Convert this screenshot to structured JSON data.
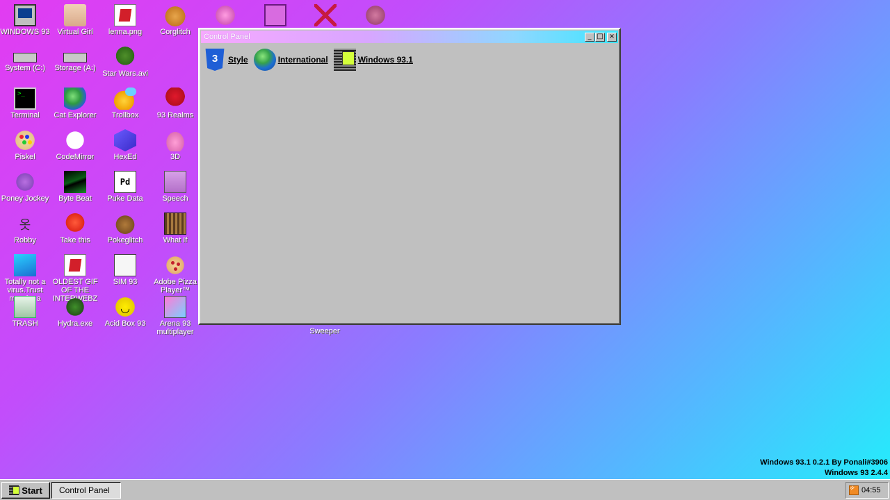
{
  "desktop": {
    "icons": [
      {
        "label": "WINDOWS 93",
        "icon": "computer-icon"
      },
      {
        "label": "Virtual Girl",
        "icon": "girl-face-icon"
      },
      {
        "label": "lenna.png",
        "icon": "image-file-icon"
      },
      {
        "label": "Corglitch",
        "icon": "corgi-icon"
      },
      {
        "label": "System (C:)",
        "icon": "hard-drive-icon"
      },
      {
        "label": "Storage (A:)",
        "icon": "floppy-drive-icon"
      },
      {
        "label": "Star Wars.avi",
        "icon": "yoda-icon"
      },
      {
        "label": "Terminal",
        "icon": "terminal-icon"
      },
      {
        "label": "Cat Explorer",
        "icon": "globe-cat-icon"
      },
      {
        "label": "Trollbox",
        "icon": "chat-icon"
      },
      {
        "label": "93 Realms",
        "icon": "mushroom-icon"
      },
      {
        "label": "Piskel",
        "icon": "palette-icon"
      },
      {
        "label": "CodeMirror",
        "icon": "cat-icon"
      },
      {
        "label": "HexEd",
        "icon": "hex-cube-icon"
      },
      {
        "label": "3D",
        "icon": "teapot-icon"
      },
      {
        "label": "Poney Jockey",
        "icon": "pony-icon"
      },
      {
        "label": "Byte Beat",
        "icon": "bytebeat-icon"
      },
      {
        "label": "Puke Data",
        "icon": "pd-icon"
      },
      {
        "label": "Speech",
        "icon": "mouth-icon"
      },
      {
        "label": "Robby",
        "icon": "stickman-icon"
      },
      {
        "label": "Take this",
        "icon": "mario-icon"
      },
      {
        "label": "Pokeglitch",
        "icon": "pokemon-icon"
      },
      {
        "label": "What If",
        "icon": "whatif-icon"
      },
      {
        "label": "Totally not a virus.Trust me...im a dolphin",
        "icon": "dolphin-icon"
      },
      {
        "label": "OLDEST GIF OF THE INTERWEBZ",
        "icon": "gif-file-icon"
      },
      {
        "label": "SIM 93",
        "icon": "book-icon"
      },
      {
        "label": "Adobe Pizza Player™",
        "icon": "pizza-icon"
      },
      {
        "label": "TRASH",
        "icon": "trash-icon"
      },
      {
        "label": "Hydra.exe",
        "icon": "hydra-icon"
      },
      {
        "label": "Acid Box 93",
        "icon": "smiley-icon"
      },
      {
        "label": "Arena 93 multiplayer",
        "icon": "cube-icon"
      }
    ],
    "top_icons": [
      {
        "icon": "robot-pink-icon"
      },
      {
        "icon": "robot-tv-icon"
      },
      {
        "icon": "crossed-swords-icon"
      },
      {
        "icon": "ogre-icon"
      }
    ],
    "hidden_label_fragment": "Sweeper"
  },
  "window": {
    "title": "Control Panel",
    "buttons": {
      "minimize": "_",
      "maximize": "□",
      "close": "×"
    },
    "items": [
      {
        "label": "Style",
        "icon": "css3-icon"
      },
      {
        "label": "International",
        "icon": "earth-icon"
      },
      {
        "label": "Windows 93.1",
        "icon": "windows93-icon"
      }
    ]
  },
  "version": {
    "line1": "Windows 93.1 0.2.1 By Ponali#3906",
    "line2": "Windows 93 2.4.4"
  },
  "taskbar": {
    "start_label": "Start",
    "tasks": [
      "Control Panel"
    ],
    "clock": "04:55"
  }
}
